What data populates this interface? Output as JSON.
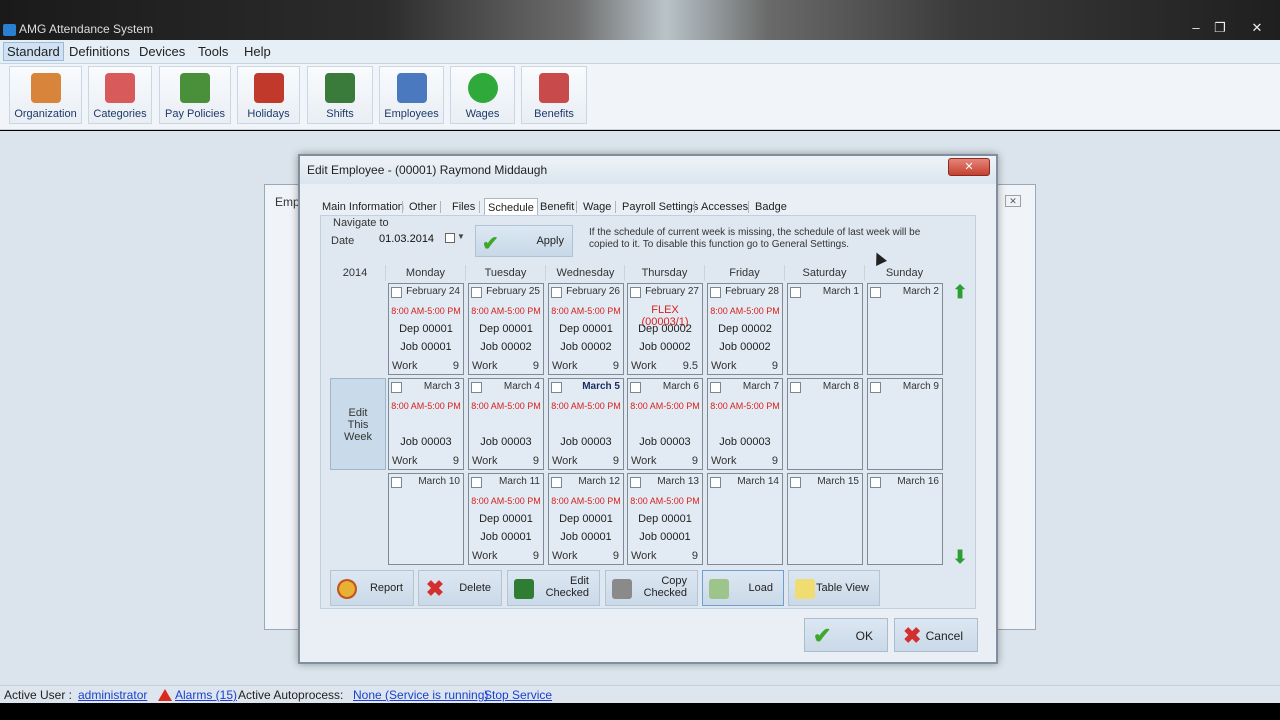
{
  "app": {
    "title": "AMG Attendance System"
  },
  "window_controls": {
    "minimize": "–",
    "restore": "❐",
    "close": "✕"
  },
  "menu": [
    "Standard",
    "Definitions",
    "Devices",
    "Tools",
    "Help"
  ],
  "toolbar": [
    {
      "label": "Organization",
      "icon": "house-icon",
      "color": "#d8843a"
    },
    {
      "label": "Categories",
      "icon": "cubes-icon",
      "color": "#d95a5a"
    },
    {
      "label": "Pay Policies",
      "icon": "flags-icon",
      "color": "#4a8f3a"
    },
    {
      "label": "Holidays",
      "icon": "calendar-icon",
      "color": "#c0392b"
    },
    {
      "label": "Shifts",
      "icon": "calendar-shift-icon",
      "color": "#3a7a3a"
    },
    {
      "label": "Employees",
      "icon": "person-icon",
      "color": "#4a79c0"
    },
    {
      "label": "Wages",
      "icon": "dollar-icon",
      "color": "#2fa93a"
    },
    {
      "label": "Benefits",
      "icon": "card-icon",
      "color": "#c94a4a"
    }
  ],
  "bg_window": {
    "title": "Emp"
  },
  "dialog": {
    "title": "Edit Employee - (00001) Raymond Middaugh",
    "close": "✕",
    "tabs": [
      "Main Information",
      "Other",
      "Files",
      "Schedule",
      "Benefit",
      "Wage",
      "Payroll Settings",
      "Accesses",
      "Badge"
    ],
    "active_tab": "Schedule",
    "navigate_label": "Navigate to",
    "date_label": "Date",
    "date_value": "01.03.2014",
    "apply": "Apply",
    "info": "If the schedule of current week is missing, the schedule of last week will be copied to it. To disable this function go to General Settings.",
    "year": "2014",
    "days": [
      "Monday",
      "Tuesday",
      "Wednesday",
      "Thursday",
      "Friday",
      "Saturday",
      "Sunday"
    ],
    "edit_week": [
      "Edit",
      "This",
      "Week"
    ],
    "weeks": [
      [
        {
          "date": "February 24",
          "time": "8:00 AM-5:00 PM",
          "dep": "Dep 00001",
          "job": "Job 00001",
          "type": "Work",
          "hours": "9"
        },
        {
          "date": "February 25",
          "time": "8:00 AM-5:00 PM",
          "dep": "Dep 00001",
          "job": "Job 00002",
          "type": "Work",
          "hours": "9"
        },
        {
          "date": "February 26",
          "time": "8:00 AM-5:00 PM",
          "dep": "Dep 00001",
          "job": "Job 00002",
          "type": "Work",
          "hours": "9"
        },
        {
          "date": "February 27",
          "time": "FLEX (00003/1)",
          "dep": "Dep 00002",
          "job": "Job 00002",
          "type": "Work",
          "hours": "9.5",
          "big": true
        },
        {
          "date": "February 28",
          "time": "8:00 AM-5:00 PM",
          "dep": "Dep 00002",
          "job": "Job 00002",
          "type": "Work",
          "hours": "9"
        },
        {
          "date": "March 1"
        },
        {
          "date": "March 2"
        }
      ],
      [
        {
          "date": "March 3",
          "time": "8:00 AM-5:00 PM",
          "job": "Job 00003",
          "type": "Work",
          "hours": "9"
        },
        {
          "date": "March 4",
          "time": "8:00 AM-5:00 PM",
          "job": "Job 00003",
          "type": "Work",
          "hours": "9"
        },
        {
          "date": "March 5",
          "time": "8:00 AM-5:00 PM",
          "job": "Job 00003",
          "type": "Work",
          "hours": "9",
          "today": true
        },
        {
          "date": "March 6",
          "time": "8:00 AM-5:00 PM",
          "job": "Job 00003",
          "type": "Work",
          "hours": "9"
        },
        {
          "date": "March 7",
          "time": "8:00 AM-5:00 PM",
          "job": "Job 00003",
          "type": "Work",
          "hours": "9"
        },
        {
          "date": "March 8"
        },
        {
          "date": "March 9"
        }
      ],
      [
        {
          "date": "March 10"
        },
        {
          "date": "March 11",
          "time": "8:00 AM-5:00 PM",
          "dep": "Dep 00001",
          "job": "Job 00001",
          "type": "Work",
          "hours": "9"
        },
        {
          "date": "March 12",
          "time": "8:00 AM-5:00 PM",
          "dep": "Dep 00001",
          "job": "Job 00001",
          "type": "Work",
          "hours": "9"
        },
        {
          "date": "March 13",
          "time": "8:00 AM-5:00 PM",
          "dep": "Dep 00001",
          "job": "Job 00001",
          "type": "Work",
          "hours": "9"
        },
        {
          "date": "March 14"
        },
        {
          "date": "March 15"
        },
        {
          "date": "March 16"
        }
      ]
    ],
    "actions": [
      {
        "label": "Report",
        "icon": "pie-chart-icon",
        "color": "#e0a020"
      },
      {
        "label": "Delete",
        "icon": "delete-icon",
        "color": "#d32f2f"
      },
      {
        "label": "Edit Checked",
        "icon": "edit-icon",
        "color": "#2e7d32"
      },
      {
        "label": "Copy Checked",
        "icon": "copy-icon",
        "color": "#777777"
      },
      {
        "label": "Load",
        "icon": "load-icon",
        "color": "#7fb86a"
      },
      {
        "label": "Table View",
        "icon": "note-icon",
        "color": "#f0dc70"
      }
    ],
    "ok": "OK",
    "cancel": "Cancel"
  },
  "status": {
    "active_user_label": "Active User :",
    "active_user": "administrator",
    "alarms": "Alarms (15)",
    "autoprocess_label": "Active Autoprocess",
    "colon": ":",
    "service_status": "None (Service is running)",
    "stop_service": "Stop Service"
  }
}
